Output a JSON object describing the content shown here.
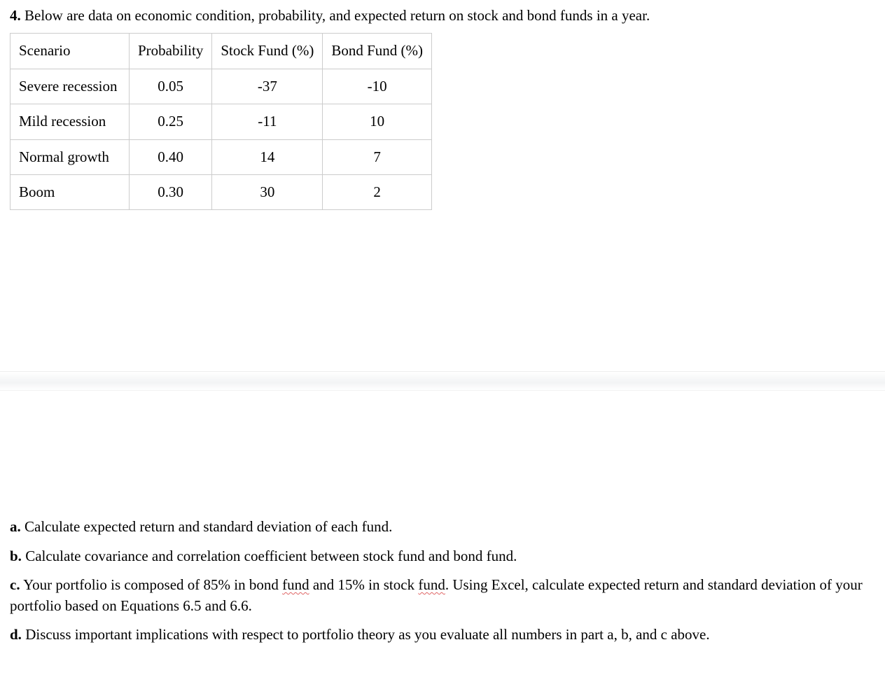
{
  "intro": {
    "number": "4.",
    "text": "Below are data on economic condition, probability, and expected return on stock and bond funds in a year."
  },
  "table": {
    "headers": [
      "Scenario",
      "Probability",
      "Stock Fund (%)",
      "Bond Fund (%)"
    ],
    "rows": [
      {
        "scenario": "Severe recession",
        "prob": "0.05",
        "stock": "-37",
        "bond": "-10"
      },
      {
        "scenario": "Mild recession",
        "prob": "0.25",
        "stock": "-11",
        "bond": "10"
      },
      {
        "scenario": "Normal growth",
        "prob": "0.40",
        "stock": "14",
        "bond": "7"
      },
      {
        "scenario": "Boom",
        "prob": "0.30",
        "stock": "30",
        "bond": "2"
      }
    ]
  },
  "questions": {
    "a": {
      "label": "a.",
      "text": "Calculate expected return and standard deviation of each fund."
    },
    "b": {
      "label": "b.",
      "text": "Calculate covariance and correlation coefficient between stock fund and bond fund."
    },
    "c": {
      "label": "c.",
      "pre": "Your portfolio is composed of 85% in bond ",
      "w1": "fund",
      "mid": " and 15% in stock ",
      "w2": "fund",
      "post": ". Using Excel, calculate expected return and standard deviation of your portfolio based on Equations 6.5 and 6.6."
    },
    "d": {
      "label": "d.",
      "text": "Discuss important implications with respect to portfolio theory as you evaluate all numbers in part a, b, and c above."
    }
  }
}
